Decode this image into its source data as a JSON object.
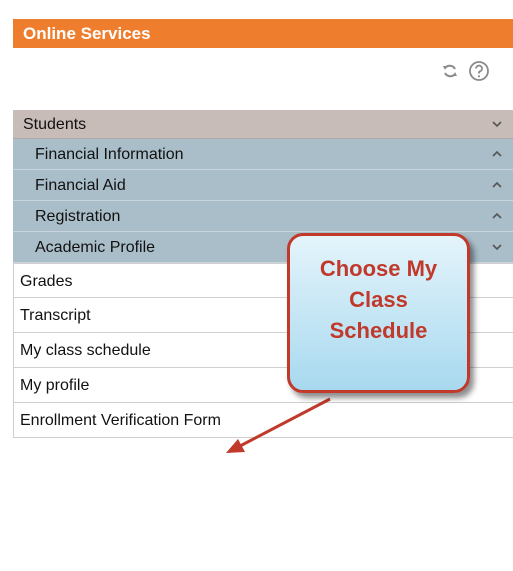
{
  "header": {
    "title": "Online Services"
  },
  "toolbar": {
    "refresh_icon": "refresh-icon",
    "help_icon": "help-icon"
  },
  "menu": {
    "students": {
      "label": "Students",
      "chevron": "chevron-down-icon"
    },
    "sections": [
      {
        "label": "Financial Information",
        "chevron": "chevron-up-icon"
      },
      {
        "label": "Financial Aid",
        "chevron": "chevron-up-icon"
      },
      {
        "label": "Registration",
        "chevron": "chevron-up-icon"
      },
      {
        "label": "Academic Profile",
        "chevron": "chevron-down-icon"
      }
    ],
    "items": [
      {
        "label": "Grades"
      },
      {
        "label": "Transcript"
      },
      {
        "label": "My class schedule"
      },
      {
        "label": "My profile"
      },
      {
        "label": "Enrollment Verification Form"
      }
    ]
  },
  "callout": {
    "lines": [
      "Choose My",
      "Class",
      "Schedule"
    ]
  },
  "colors": {
    "header_bg": "#ee7e2d",
    "students_bg": "#c8bcb8",
    "section_bg": "#a9bec9",
    "callout_border": "#c0392b",
    "callout_text": "#c0392b"
  }
}
